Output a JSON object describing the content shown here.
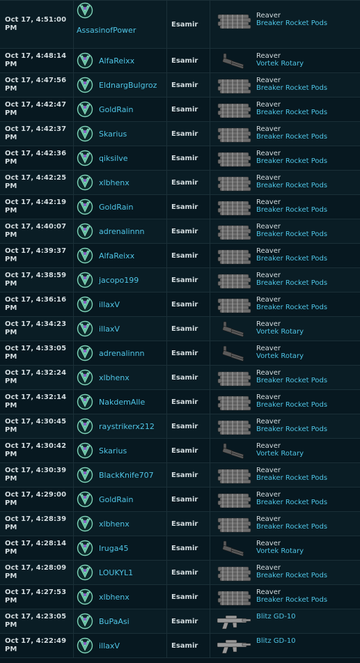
{
  "kills": [
    {
      "time": "Oct 17, 4:51:00 PM",
      "pilot": "AssasinofPower",
      "system": "Esamir",
      "ship": "Reaver",
      "weapon": "Breaker Rocket Pods",
      "icon": "rocket-pods"
    },
    {
      "time": "Oct 17, 4:48:14 PM",
      "pilot": "AlfaReixx",
      "system": "Esamir",
      "ship": "Reaver",
      "weapon": "Vortek Rotary",
      "icon": "rotary"
    },
    {
      "time": "Oct 17, 4:47:56 PM",
      "pilot": "EldnargBulgroz",
      "system": "Esamir",
      "ship": "Reaver",
      "weapon": "Breaker Rocket Pods",
      "icon": "rocket-pods"
    },
    {
      "time": "Oct 17, 4:42:47 PM",
      "pilot": "GoldRain",
      "system": "Esamir",
      "ship": "Reaver",
      "weapon": "Breaker Rocket Pods",
      "icon": "rocket-pods"
    },
    {
      "time": "Oct 17, 4:42:37 PM",
      "pilot": "Skarius",
      "system": "Esamir",
      "ship": "Reaver",
      "weapon": "Breaker Rocket Pods",
      "icon": "rocket-pods"
    },
    {
      "time": "Oct 17, 4:42:36 PM",
      "pilot": "qiksilve",
      "system": "Esamir",
      "ship": "Reaver",
      "weapon": "Breaker Rocket Pods",
      "icon": "rocket-pods"
    },
    {
      "time": "Oct 17, 4:42:25 PM",
      "pilot": "xlbhenx",
      "system": "Esamir",
      "ship": "Reaver",
      "weapon": "Breaker Rocket Pods",
      "icon": "rocket-pods"
    },
    {
      "time": "Oct 17, 4:42:19 PM",
      "pilot": "GoldRain",
      "system": "Esamir",
      "ship": "Reaver",
      "weapon": "Breaker Rocket Pods",
      "icon": "rocket-pods"
    },
    {
      "time": "Oct 17, 4:40:07 PM",
      "pilot": "adrenalinnn",
      "system": "Esamir",
      "ship": "Reaver",
      "weapon": "Breaker Rocket Pods",
      "icon": "rocket-pods"
    },
    {
      "time": "Oct 17, 4:39:37 PM",
      "pilot": "AlfaReixx",
      "system": "Esamir",
      "ship": "Reaver",
      "weapon": "Breaker Rocket Pods",
      "icon": "rocket-pods"
    },
    {
      "time": "Oct 17, 4:38:59 PM",
      "pilot": "jacopo199",
      "system": "Esamir",
      "ship": "Reaver",
      "weapon": "Breaker Rocket Pods",
      "icon": "rocket-pods"
    },
    {
      "time": "Oct 17, 4:36:16 PM",
      "pilot": "illaxV",
      "system": "Esamir",
      "ship": "Reaver",
      "weapon": "Breaker Rocket Pods",
      "icon": "rocket-pods"
    },
    {
      "time": "Oct 17, 4:34:23 PM",
      "pilot": "illaxV",
      "system": "Esamir",
      "ship": "Reaver",
      "weapon": "Vortek Rotary",
      "icon": "rotary"
    },
    {
      "time": "Oct 17, 4:33:05 PM",
      "pilot": "adrenalinnn",
      "system": "Esamir",
      "ship": "Reaver",
      "weapon": "Vortek Rotary",
      "icon": "rotary"
    },
    {
      "time": "Oct 17, 4:32:24 PM",
      "pilot": "xlbhenx",
      "system": "Esamir",
      "ship": "Reaver",
      "weapon": "Breaker Rocket Pods",
      "icon": "rocket-pods"
    },
    {
      "time": "Oct 17, 4:32:14 PM",
      "pilot": "NakdemAlle",
      "system": "Esamir",
      "ship": "Reaver",
      "weapon": "Breaker Rocket Pods",
      "icon": "rocket-pods"
    },
    {
      "time": "Oct 17, 4:30:45 PM",
      "pilot": "raystrikerx212",
      "system": "Esamir",
      "ship": "Reaver",
      "weapon": "Breaker Rocket Pods",
      "icon": "rocket-pods"
    },
    {
      "time": "Oct 17, 4:30:42 PM",
      "pilot": "Skarius",
      "system": "Esamir",
      "ship": "Reaver",
      "weapon": "Vortek Rotary",
      "icon": "rotary"
    },
    {
      "time": "Oct 17, 4:30:39 PM",
      "pilot": "BlackKnife707",
      "system": "Esamir",
      "ship": "Reaver",
      "weapon": "Breaker Rocket Pods",
      "icon": "rocket-pods"
    },
    {
      "time": "Oct 17, 4:29:00 PM",
      "pilot": "GoldRain",
      "system": "Esamir",
      "ship": "Reaver",
      "weapon": "Breaker Rocket Pods",
      "icon": "rocket-pods"
    },
    {
      "time": "Oct 17, 4:28:39 PM",
      "pilot": "xlbhenx",
      "system": "Esamir",
      "ship": "Reaver",
      "weapon": "Breaker Rocket Pods",
      "icon": "rocket-pods"
    },
    {
      "time": "Oct 17, 4:28:14 PM",
      "pilot": "Iruga45",
      "system": "Esamir",
      "ship": "Reaver",
      "weapon": "Vortek Rotary",
      "icon": "rotary"
    },
    {
      "time": "Oct 17, 4:28:09 PM",
      "pilot": "LOUKYL1",
      "system": "Esamir",
      "ship": "Reaver",
      "weapon": "Breaker Rocket Pods",
      "icon": "rocket-pods"
    },
    {
      "time": "Oct 17, 4:27:53 PM",
      "pilot": "xlbhenx",
      "system": "Esamir",
      "ship": "Reaver",
      "weapon": "Breaker Rocket Pods",
      "icon": "rocket-pods"
    },
    {
      "time": "Oct 17, 4:23:05 PM",
      "pilot": "BuPaAsi",
      "system": "Esamir",
      "ship": "",
      "weapon": "Blitz GD-10",
      "icon": "rifle"
    },
    {
      "time": "Oct 17, 4:22:49 PM",
      "pilot": "illaxV",
      "system": "Esamir",
      "ship": "",
      "weapon": "Blitz GD-10",
      "icon": "rifle"
    }
  ],
  "colors": {
    "background": "#08161e",
    "link": "#4fc5e6",
    "text": "#d4dde0",
    "border": "#1b3038"
  }
}
